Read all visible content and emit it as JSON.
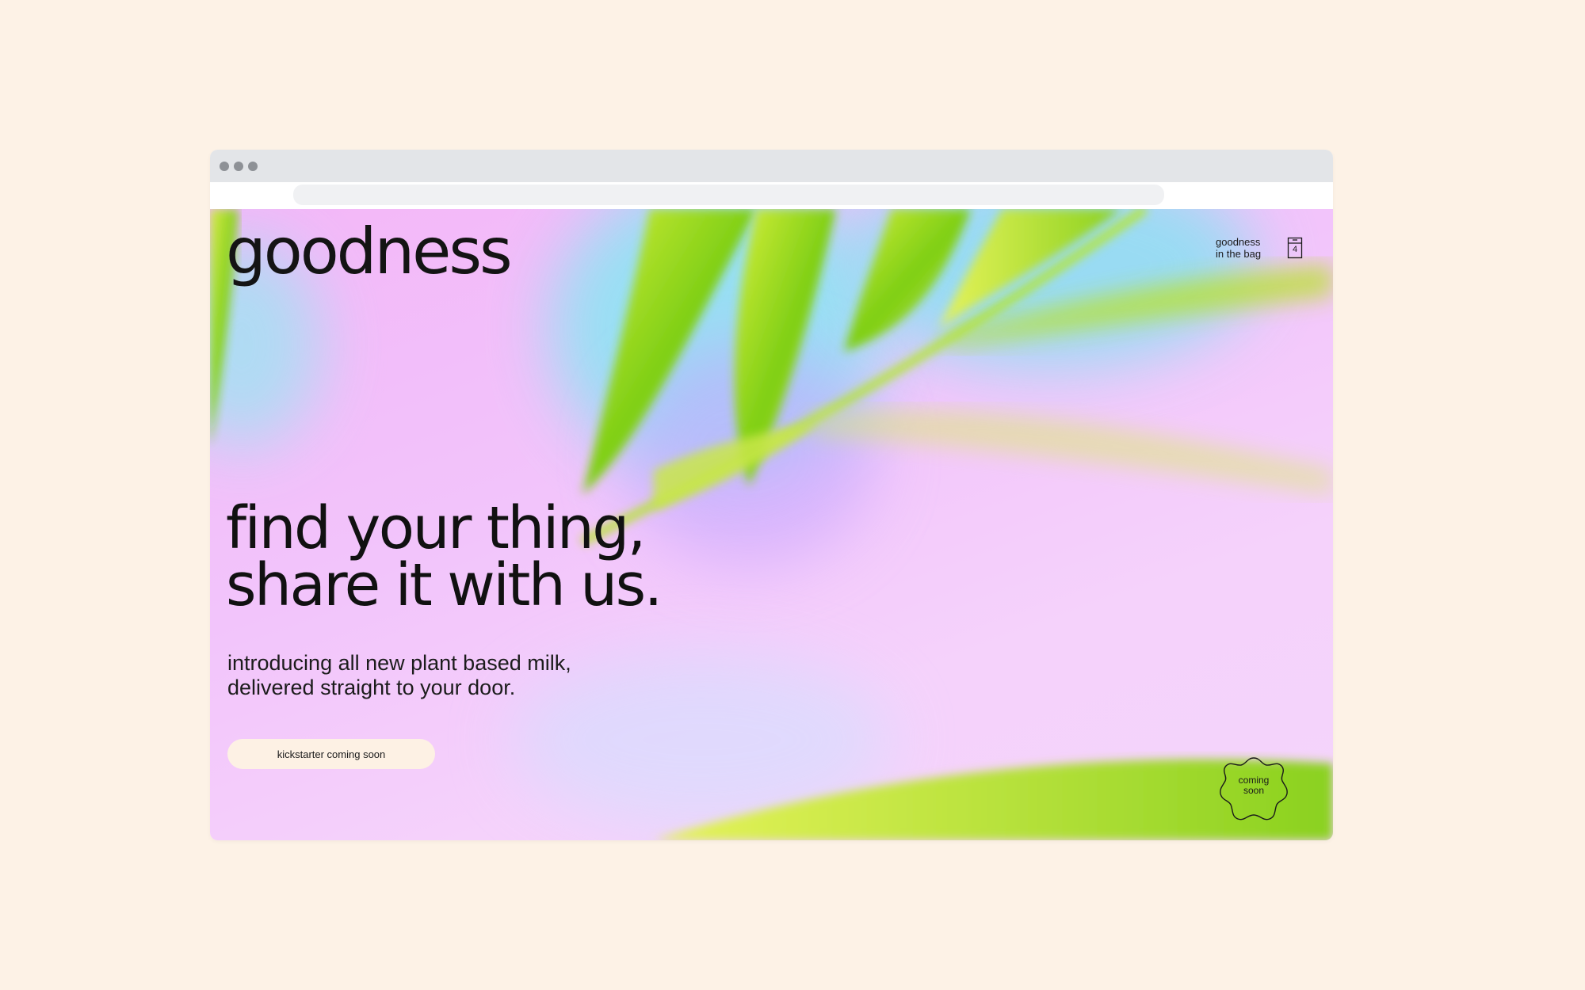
{
  "brand": {
    "logo": "goodness"
  },
  "header": {
    "bag_label_line1": "goodness",
    "bag_label_line2": "in the bag",
    "bag_count": "4"
  },
  "hero": {
    "headline_line1": "find your thing,",
    "headline_line2": "share it with us.",
    "subtext_line1": "introducing all new plant based milk,",
    "subtext_line2": "delivered straight to your door.",
    "cta_label": "kickstarter coming soon"
  },
  "badge": {
    "line1": "coming",
    "line2": "soon"
  },
  "colors": {
    "page_background": "#fdf2e6",
    "hero_pink": "#f3b7f8",
    "sky_blue": "#86dff0",
    "leaf_green": "#9fe01a",
    "button_background": "#fdf1e4",
    "text": "#111111"
  },
  "icons": {
    "bag": "shopping-bag-icon",
    "badge": "scalloped-badge-icon"
  }
}
